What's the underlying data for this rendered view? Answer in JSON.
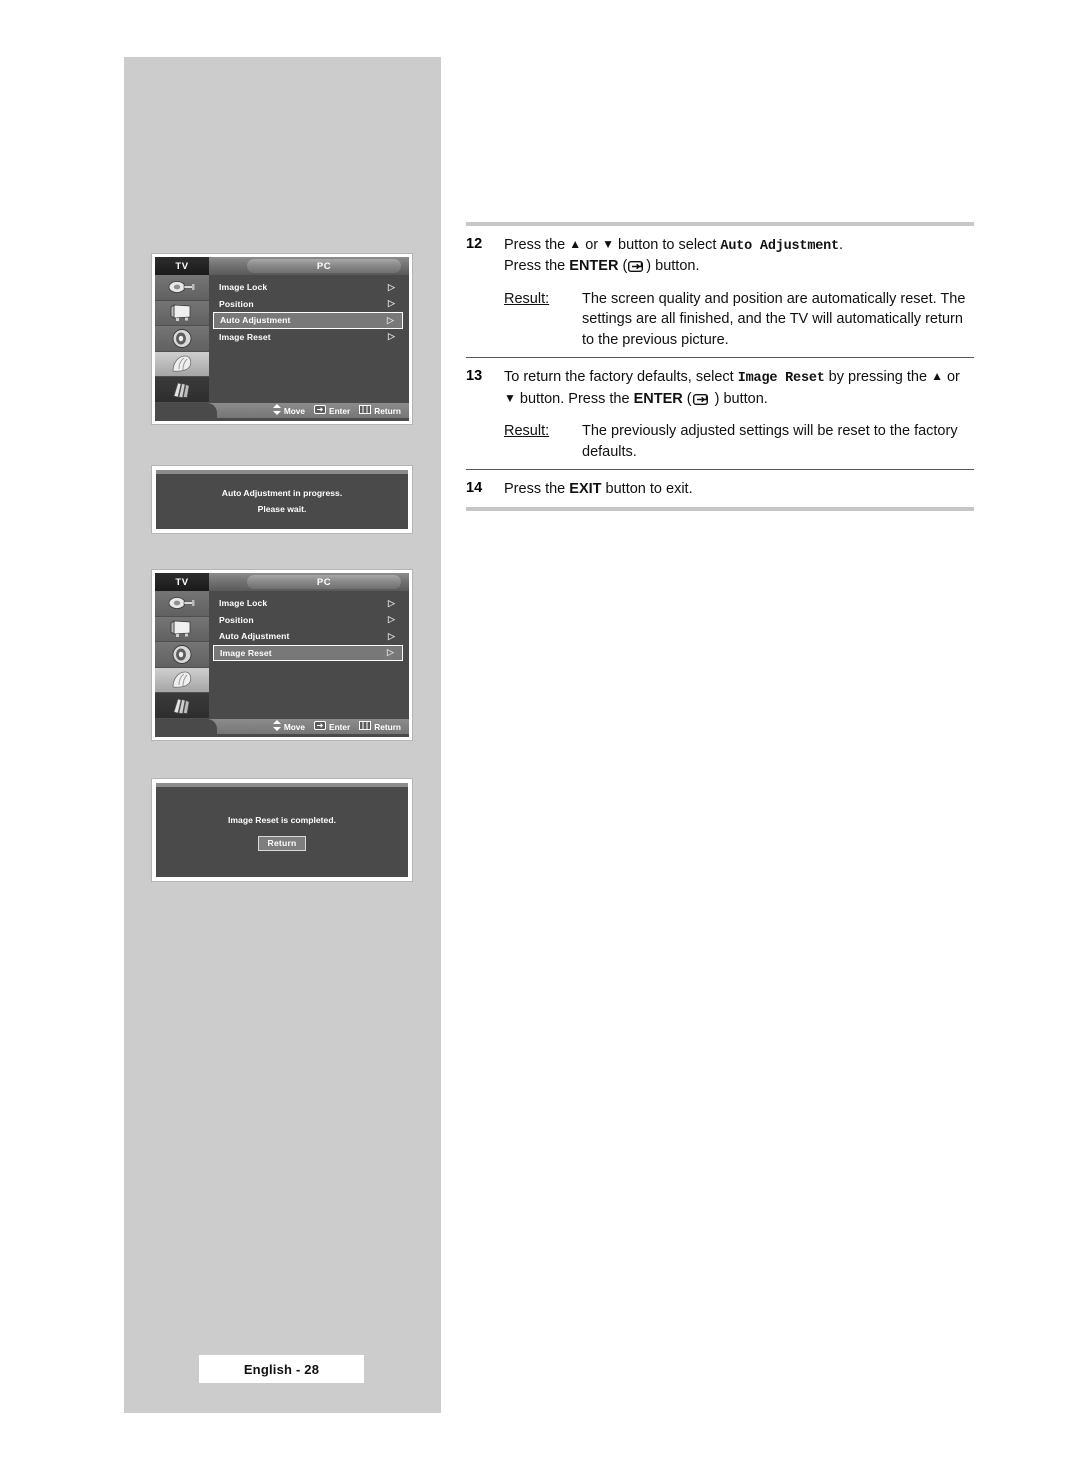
{
  "page": {
    "footer_tag": "English - 28"
  },
  "osd_menus": [
    {
      "id": "auto-adjustment",
      "tab_tv": "TV",
      "tab_pc": "PC",
      "items": [
        {
          "label": "Image Lock",
          "arrow": "▷",
          "selected": false
        },
        {
          "label": "Position",
          "arrow": "▷",
          "selected": false
        },
        {
          "label": "Auto Adjustment",
          "arrow": "▷",
          "selected": true
        },
        {
          "label": "Image Reset",
          "arrow": "▷",
          "selected": false
        }
      ],
      "rail_icons": [
        "cable-input-icon",
        "tv-picture-icon",
        "speaker-sound-icon",
        "setup-icon",
        "pc-hand-icon"
      ],
      "footer": {
        "move": "Move",
        "enter": "Enter",
        "return": "Return"
      }
    },
    {
      "id": "image-reset",
      "tab_tv": "TV",
      "tab_pc": "PC",
      "items": [
        {
          "label": "Image Lock",
          "arrow": "▷",
          "selected": false
        },
        {
          "label": "Position",
          "arrow": "▷",
          "selected": false
        },
        {
          "label": "Auto Adjustment",
          "arrow": "▷",
          "selected": false
        },
        {
          "label": "Image Reset",
          "arrow": "▷",
          "selected": true
        }
      ],
      "rail_icons": [
        "cable-input-icon",
        "tv-picture-icon",
        "speaker-sound-icon",
        "setup-icon",
        "pc-hand-icon"
      ],
      "footer": {
        "move": "Move",
        "enter": "Enter",
        "return": "Return"
      }
    }
  ],
  "popups": [
    {
      "id": "auto-adjustment-progress",
      "line1": "Auto Adjustment in progress.",
      "line2": "Please wait.",
      "button": null
    },
    {
      "id": "image-reset-complete",
      "line1": "Image Reset is completed.",
      "line2": "",
      "button": "Return"
    }
  ],
  "steps": [
    {
      "num": "12",
      "text_parts": [
        {
          "t": "Press the "
        },
        {
          "t": "▲",
          "style": "tri"
        },
        {
          "t": " or "
        },
        {
          "t": "▼",
          "style": "tri"
        },
        {
          "t": " button to select "
        },
        {
          "t": "Auto Adjustment",
          "style": "mono"
        },
        {
          "t": "."
        },
        {
          "t": "\n"
        },
        {
          "t": "Press the "
        },
        {
          "t": "ENTER",
          "style": "bold"
        },
        {
          "t": " (",
          "style": ""
        },
        {
          "t": "enter-icon",
          "style": "icon"
        },
        {
          "t": ") button."
        }
      ],
      "result_label": "Result:",
      "result_text": "The screen quality and position are automatically reset. The settings are all finished, and the TV will automatically return to the previous picture."
    },
    {
      "num": "13",
      "text_parts": [
        {
          "t": "To return the factory defaults, select "
        },
        {
          "t": "Image Reset",
          "style": "mono"
        },
        {
          "t": " by pressing the "
        },
        {
          "t": "▲",
          "style": "tri"
        },
        {
          "t": " or "
        },
        {
          "t": "▼",
          "style": "tri"
        },
        {
          "t": " button. Press the "
        },
        {
          "t": "ENTER",
          "style": "bold"
        },
        {
          "t": " ("
        },
        {
          "t": "enter-icon",
          "style": "icon"
        },
        {
          "t": " ) button."
        }
      ],
      "result_label": "Result:",
      "result_text": "The previously adjusted settings will be reset to the factory defaults."
    },
    {
      "num": "14",
      "text_parts": [
        {
          "t": "Press the "
        },
        {
          "t": "EXIT",
          "style": "bold"
        },
        {
          "t": " button to exit."
        }
      ],
      "result_label": null,
      "result_text": null
    }
  ],
  "labels": {
    "step12_line1_pre": "Press the ",
    "step12_line1_mid": " or ",
    "step12_line1_post": " button to select ",
    "step12_mono": "Auto Adjustment",
    "step12_period": ".",
    "step12_line2_pre": "Press the ",
    "step12_enter": "ENTER",
    "step12_line2_post": ") button.",
    "step12_result_label": "Result:",
    "step12_result": "The screen quality and position are automatically reset. The settings are all finished, and the TV will automatically return to the previous picture.",
    "step13_pre": "To return the factory defaults, select ",
    "step13_mono": "Image Reset",
    "step13_mid": " by pressing the ",
    "step13_or": " or ",
    "step13_post": " button. Press the ",
    "step13_enter": "ENTER",
    "step13_tail": " ) button.",
    "step13_result_label": "Result:",
    "step13_result": "The previously adjusted settings will be reset to the factory defaults.",
    "step14_pre": "Press the ",
    "step14_exit": "EXIT",
    "step14_post": " button to exit.",
    "num12": "12",
    "num13": "13",
    "num14": "14"
  },
  "colors": {
    "page_panel": "#cccccc",
    "osd_background": "#4a4a4a",
    "osd_highlight": "#787878",
    "rule_thick": "#c6c6c6",
    "rule_thin": "#555555"
  }
}
